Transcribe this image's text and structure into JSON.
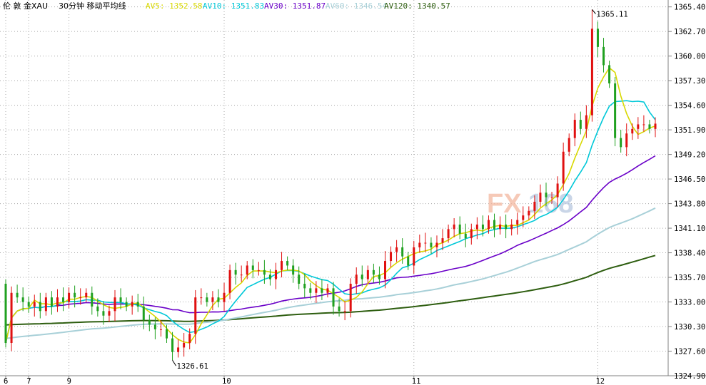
{
  "header": {
    "title": "伦 敦 金XAU",
    "period": "30分钟 移动平均线",
    "ma": [
      {
        "label": "AV5: 1352.58",
        "color": "#d8d800"
      },
      {
        "label": "AV10: 1351.83",
        "color": "#00c8d8"
      },
      {
        "label": "AV30: 1351.87",
        "color": "#6a00c8"
      },
      {
        "label": "AV60: 1346.54",
        "color": "#a8d0d8"
      },
      {
        "label": "AV120: 1340.57",
        "color": "#2e5e10"
      }
    ]
  },
  "watermark": {
    "text1": "FX",
    "text2": "168"
  },
  "chart_data": {
    "type": "candlestick",
    "ylim": [
      1324.9,
      1366.0
    ],
    "yticks": [
      "1365.40",
      "1362.70",
      "1360.00",
      "1357.30",
      "1354.60",
      "1351.90",
      "1349.20",
      "1346.50",
      "1343.80",
      "1341.10",
      "1338.40",
      "1335.70",
      "1333.00",
      "1330.30",
      "1327.60",
      "1324.90"
    ],
    "xticks": [
      {
        "label": "6",
        "index": 0
      },
      {
        "label": "7",
        "index": 4
      },
      {
        "label": "9",
        "index": 11
      },
      {
        "label": "10",
        "index": 38
      },
      {
        "label": "11",
        "index": 71
      },
      {
        "label": "12",
        "index": 103
      }
    ],
    "annotations": [
      {
        "text": "1365.11",
        "index": 102,
        "value": 1365.11
      },
      {
        "text": "1326.61",
        "index": 29,
        "value": 1326.61
      }
    ],
    "closes": [
      1328.5,
      1334.0,
      1333.5,
      1333.0,
      1332.5,
      1333.0,
      1332.0,
      1333.5,
      1332.5,
      1333.5,
      1333.0,
      1334.0,
      1333.5,
      1333.5,
      1334.0,
      1332.5,
      1332.0,
      1331.5,
      1332.0,
      1333.5,
      1333.0,
      1332.5,
      1333.0,
      1332.5,
      1331.0,
      1330.5,
      1330.0,
      1330.0,
      1329.0,
      1327.5,
      1328.0,
      1328.5,
      1329.5,
      1333.5,
      1333.5,
      1333.0,
      1333.5,
      1333.0,
      1334.0,
      1336.5,
      1336.0,
      1336.0,
      1337.0,
      1336.5,
      1336.5,
      1336.0,
      1335.5,
      1336.5,
      1337.5,
      1337.0,
      1336.0,
      1335.0,
      1334.5,
      1334.0,
      1334.5,
      1334.0,
      1334.5,
      1332.5,
      1332.0,
      1332.0,
      1335.0,
      1336.0,
      1335.5,
      1336.5,
      1336.0,
      1335.5,
      1337.5,
      1338.5,
      1339.0,
      1338.0,
      1337.0,
      1339.0,
      1339.5,
      1339.5,
      1339.0,
      1339.5,
      1340.0,
      1341.0,
      1341.5,
      1340.5,
      1340.0,
      1341.0,
      1341.5,
      1341.0,
      1342.0,
      1341.0,
      1341.5,
      1341.0,
      1341.5,
      1342.0,
      1342.5,
      1343.0,
      1344.0,
      1345.0,
      1344.5,
      1344.5,
      1346.0,
      1349.5,
      1351.0,
      1353.0,
      1352.0,
      1353.5,
      1363.0,
      1361.0,
      1359.0,
      1357.0,
      1351.0,
      1350.0,
      1351.5,
      1352.0,
      1352.5,
      1352.5,
      1352.0,
      1352.58
    ],
    "ma_values": {
      "AV5": 1352.58,
      "AV10": 1351.83,
      "AV30": 1351.87,
      "AV60": 1346.54,
      "AV120": 1340.57
    }
  }
}
